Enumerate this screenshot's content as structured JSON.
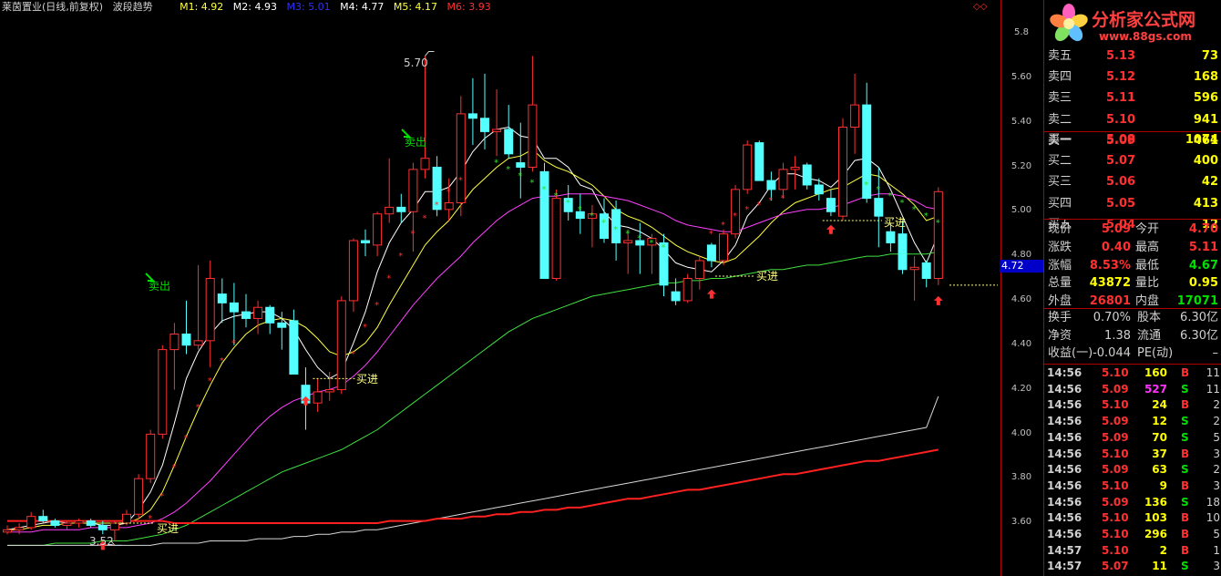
{
  "title_bar": {
    "stock": "莱茵置业(日线,前复权)",
    "indicator": "波段趋势",
    "m1": "M1: 4.92",
    "m2": "M2: 4.93",
    "m3": "M3: 5.01",
    "m4": "M4: 4.77",
    "m5": "M5: 4.17",
    "m6": "M6: 3.93",
    "colors": {
      "m1": "#ffff40",
      "m2": "#ffffff",
      "m3": "#2020ff",
      "m4": "#ffffff",
      "m5": "#ffff40",
      "m6": "#ff3030"
    }
  },
  "price_axis": {
    "ticks": [
      "5.8",
      "5.60",
      "5.40",
      "5.20",
      "5.00",
      "4.80",
      "4.60",
      "4.40",
      "4.20",
      "4.00",
      "3.80",
      "3.60"
    ],
    "current_tag": "4.72"
  },
  "annotations": {
    "high_label": "5.70",
    "low_label": "3.52",
    "sell": "卖出",
    "buy": "买进"
  },
  "logo": {
    "text": "分析家公式网",
    "url": "www.88gs.com"
  },
  "order_book": {
    "asks": [
      {
        "label": "卖五",
        "price": "5.13",
        "vol": "73"
      },
      {
        "label": "卖四",
        "price": "5.12",
        "vol": "168"
      },
      {
        "label": "卖三",
        "price": "5.11",
        "vol": "596"
      },
      {
        "label": "卖二",
        "price": "5.10",
        "vol": "941"
      },
      {
        "label": "卖一",
        "price": "5.09",
        "vol": "461"
      }
    ],
    "bids": [
      {
        "label": "买一",
        "price": "5.08",
        "vol": "1074"
      },
      {
        "label": "买二",
        "price": "5.07",
        "vol": "400"
      },
      {
        "label": "买三",
        "price": "5.06",
        "vol": "42"
      },
      {
        "label": "买四",
        "price": "5.05",
        "vol": "413"
      },
      {
        "label": "买五",
        "price": "5.04",
        "vol": "12"
      }
    ]
  },
  "quote": {
    "rows": [
      {
        "l1": "现价",
        "v1": "5.09",
        "l2": "今开",
        "v2": "4.70"
      },
      {
        "l1": "涨跌",
        "v1": "0.40",
        "l2": "最高",
        "v2": "5.11"
      },
      {
        "l1": "涨幅",
        "v1": "8.53%",
        "l2": "最低",
        "v2": "4.67"
      },
      {
        "l1": "总量",
        "v1": "43872",
        "l2": "量比",
        "v2": "0.95"
      },
      {
        "l1": "外盘",
        "v1": "26801",
        "l2": "内盘",
        "v2": "17071"
      }
    ]
  },
  "fundamentals": {
    "rows": [
      {
        "l1": "换手",
        "v1": "0.70%",
        "l2": "股本",
        "v2": "6.30亿"
      },
      {
        "l1": "净资",
        "v1": "1.38",
        "l2": "流通",
        "v2": "6.30亿"
      },
      {
        "l1": "收益(一)",
        "v1": "-0.044",
        "l2": "PE(动)",
        "v2": "–"
      }
    ]
  },
  "ticks": [
    {
      "time": "14:56",
      "price": "5.10",
      "vol": "160",
      "side": "B",
      "n": "11"
    },
    {
      "time": "14:56",
      "price": "5.09",
      "vol": "527",
      "side": "S",
      "n": "11"
    },
    {
      "time": "14:56",
      "price": "5.10",
      "vol": "24",
      "side": "B",
      "n": "2"
    },
    {
      "time": "14:56",
      "price": "5.09",
      "vol": "12",
      "side": "S",
      "n": "2"
    },
    {
      "time": "14:56",
      "price": "5.09",
      "vol": "70",
      "side": "S",
      "n": "5"
    },
    {
      "time": "14:56",
      "price": "5.10",
      "vol": "37",
      "side": "B",
      "n": "3"
    },
    {
      "time": "14:56",
      "price": "5.09",
      "vol": "63",
      "side": "S",
      "n": "2"
    },
    {
      "time": "14:56",
      "price": "5.10",
      "vol": "9",
      "side": "B",
      "n": "3"
    },
    {
      "time": "14:56",
      "price": "5.09",
      "vol": "136",
      "side": "S",
      "n": "18"
    },
    {
      "time": "14:56",
      "price": "5.10",
      "vol": "103",
      "side": "B",
      "n": "10"
    },
    {
      "time": "14:56",
      "price": "5.10",
      "vol": "296",
      "side": "B",
      "n": "5"
    },
    {
      "time": "14:57",
      "price": "5.10",
      "vol": "2",
      "side": "B",
      "n": "1"
    },
    {
      "time": "14:57",
      "price": "5.07",
      "vol": "11",
      "side": "S",
      "n": "3"
    }
  ],
  "chart_data": {
    "type": "candlestick",
    "ylim": [
      3.5,
      5.85
    ],
    "candles": [
      {
        "o": 3.56,
        "h": 3.59,
        "l": 3.55,
        "c": 3.57
      },
      {
        "o": 3.57,
        "h": 3.6,
        "l": 3.55,
        "c": 3.58
      },
      {
        "o": 3.58,
        "h": 3.65,
        "l": 3.57,
        "c": 3.63
      },
      {
        "o": 3.63,
        "h": 3.66,
        "l": 3.6,
        "c": 3.61
      },
      {
        "o": 3.61,
        "h": 3.62,
        "l": 3.58,
        "c": 3.59
      },
      {
        "o": 3.59,
        "h": 3.61,
        "l": 3.57,
        "c": 3.6
      },
      {
        "o": 3.6,
        "h": 3.62,
        "l": 3.58,
        "c": 3.61
      },
      {
        "o": 3.61,
        "h": 3.62,
        "l": 3.58,
        "c": 3.59
      },
      {
        "o": 3.59,
        "h": 3.61,
        "l": 3.55,
        "c": 3.57
      },
      {
        "o": 3.57,
        "h": 3.61,
        "l": 3.52,
        "c": 3.6
      },
      {
        "o": 3.6,
        "h": 3.66,
        "l": 3.59,
        "c": 3.64
      },
      {
        "o": 3.64,
        "h": 3.82,
        "l": 3.62,
        "c": 3.8
      },
      {
        "o": 3.8,
        "h": 4.02,
        "l": 3.78,
        "c": 4.0
      },
      {
        "o": 4.0,
        "h": 4.4,
        "l": 3.98,
        "c": 4.38
      },
      {
        "o": 4.38,
        "h": 4.5,
        "l": 4.2,
        "c": 4.45
      },
      {
        "o": 4.45,
        "h": 4.6,
        "l": 4.36,
        "c": 4.4
      },
      {
        "o": 4.4,
        "h": 4.76,
        "l": 4.38,
        "c": 4.42
      },
      {
        "o": 4.42,
        "h": 4.78,
        "l": 4.3,
        "c": 4.7
      },
      {
        "o": 4.63,
        "h": 4.7,
        "l": 4.5,
        "c": 4.59
      },
      {
        "o": 4.59,
        "h": 4.68,
        "l": 4.4,
        "c": 4.55
      },
      {
        "o": 4.55,
        "h": 4.63,
        "l": 4.48,
        "c": 4.52
      },
      {
        "o": 4.52,
        "h": 4.6,
        "l": 4.45,
        "c": 4.57
      },
      {
        "o": 4.57,
        "h": 4.58,
        "l": 4.45,
        "c": 4.5
      },
      {
        "o": 4.5,
        "h": 4.55,
        "l": 4.38,
        "c": 4.48
      },
      {
        "o": 4.51,
        "h": 4.56,
        "l": 4.3,
        "c": 4.27
      },
      {
        "o": 4.22,
        "h": 4.3,
        "l": 4.02,
        "c": 4.14
      },
      {
        "o": 4.14,
        "h": 4.25,
        "l": 4.1,
        "c": 4.19
      },
      {
        "o": 4.19,
        "h": 4.28,
        "l": 4.15,
        "c": 4.2
      },
      {
        "o": 4.2,
        "h": 4.62,
        "l": 4.18,
        "c": 4.6
      },
      {
        "o": 4.6,
        "h": 4.88,
        "l": 4.55,
        "c": 4.87
      },
      {
        "o": 4.87,
        "h": 4.92,
        "l": 4.8,
        "c": 4.86
      },
      {
        "o": 4.85,
        "h": 5.0,
        "l": 4.8,
        "c": 4.99
      },
      {
        "o": 4.99,
        "h": 5.24,
        "l": 4.95,
        "c": 5.02
      },
      {
        "o": 5.02,
        "h": 5.08,
        "l": 4.95,
        "c": 5.0
      },
      {
        "o": 5.0,
        "h": 5.22,
        "l": 4.82,
        "c": 5.19
      },
      {
        "o": 5.19,
        "h": 5.7,
        "l": 5.15,
        "c": 5.24
      },
      {
        "o": 5.2,
        "h": 5.25,
        "l": 4.98,
        "c": 5.01
      },
      {
        "o": 5.01,
        "h": 5.15,
        "l": 4.96,
        "c": 5.04
      },
      {
        "o": 5.04,
        "h": 5.52,
        "l": 4.98,
        "c": 5.44
      },
      {
        "o": 5.44,
        "h": 5.6,
        "l": 5.3,
        "c": 5.42
      },
      {
        "o": 5.42,
        "h": 5.62,
        "l": 5.28,
        "c": 5.36
      },
      {
        "o": 5.36,
        "h": 5.55,
        "l": 5.25,
        "c": 5.37
      },
      {
        "o": 5.37,
        "h": 5.48,
        "l": 5.24,
        "c": 5.26
      },
      {
        "o": 5.22,
        "h": 5.4,
        "l": 5.06,
        "c": 5.2
      },
      {
        "o": 5.2,
        "h": 5.7,
        "l": 5.18,
        "c": 5.48
      },
      {
        "o": 5.18,
        "h": 5.22,
        "l": 4.75,
        "c": 4.7
      },
      {
        "o": 4.7,
        "h": 5.1,
        "l": 4.69,
        "c": 5.06
      },
      {
        "o": 5.06,
        "h": 5.12,
        "l": 4.96,
        "c": 5.0
      },
      {
        "o": 5.0,
        "h": 5.08,
        "l": 4.9,
        "c": 4.97
      },
      {
        "o": 4.97,
        "h": 5.03,
        "l": 4.84,
        "c": 4.99
      },
      {
        "o": 4.99,
        "h": 5.06,
        "l": 4.86,
        "c": 4.88
      },
      {
        "o": 5.01,
        "h": 5.05,
        "l": 4.78,
        "c": 4.86
      },
      {
        "o": 4.86,
        "h": 4.92,
        "l": 4.72,
        "c": 4.87
      },
      {
        "o": 4.87,
        "h": 4.95,
        "l": 4.72,
        "c": 4.85
      },
      {
        "o": 4.85,
        "h": 4.9,
        "l": 4.72,
        "c": 4.88
      },
      {
        "o": 4.86,
        "h": 4.9,
        "l": 4.62,
        "c": 4.67
      },
      {
        "o": 4.64,
        "h": 4.7,
        "l": 4.58,
        "c": 4.6
      },
      {
        "o": 4.6,
        "h": 4.72,
        "l": 4.59,
        "c": 4.7
      },
      {
        "o": 4.7,
        "h": 4.8,
        "l": 4.65,
        "c": 4.78
      },
      {
        "o": 4.85,
        "h": 4.86,
        "l": 4.75,
        "c": 4.78
      },
      {
        "o": 4.78,
        "h": 4.92,
        "l": 4.76,
        "c": 4.9
      },
      {
        "o": 4.9,
        "h": 5.12,
        "l": 4.88,
        "c": 5.1
      },
      {
        "o": 5.1,
        "h": 5.32,
        "l": 5.08,
        "c": 5.3
      },
      {
        "o": 5.31,
        "h": 5.32,
        "l": 5.14,
        "c": 5.14
      },
      {
        "o": 5.14,
        "h": 5.18,
        "l": 5.05,
        "c": 5.1
      },
      {
        "o": 5.1,
        "h": 5.22,
        "l": 5.06,
        "c": 5.19
      },
      {
        "o": 5.19,
        "h": 5.25,
        "l": 5.1,
        "c": 5.2
      },
      {
        "o": 5.21,
        "h": 5.22,
        "l": 5.1,
        "c": 5.12
      },
      {
        "o": 5.12,
        "h": 5.15,
        "l": 5.05,
        "c": 5.08
      },
      {
        "o": 5.06,
        "h": 5.1,
        "l": 4.98,
        "c": 5.0
      },
      {
        "o": 4.98,
        "h": 5.42,
        "l": 4.96,
        "c": 5.38
      },
      {
        "o": 5.38,
        "h": 5.62,
        "l": 5.26,
        "c": 5.48
      },
      {
        "o": 5.48,
        "h": 5.58,
        "l": 5.04,
        "c": 5.06
      },
      {
        "o": 5.06,
        "h": 5.2,
        "l": 4.84,
        "c": 4.98
      },
      {
        "o": 4.91,
        "h": 4.95,
        "l": 4.82,
        "c": 4.86
      },
      {
        "o": 4.9,
        "h": 4.96,
        "l": 4.72,
        "c": 4.74
      },
      {
        "o": 4.74,
        "h": 4.8,
        "l": 4.6,
        "c": 4.75
      },
      {
        "o": 4.77,
        "h": 4.78,
        "l": 4.66,
        "c": 4.7
      },
      {
        "o": 4.7,
        "h": 5.11,
        "l": 4.67,
        "c": 5.09
      }
    ],
    "ma_series": [
      {
        "name": "M1",
        "color": "#ffffff",
        "values": [
          3.57,
          3.58,
          3.59,
          3.6,
          3.61,
          3.6,
          3.6,
          3.6,
          3.59,
          3.59,
          3.6,
          3.66,
          3.74,
          3.86,
          4.05,
          4.25,
          4.37,
          4.45,
          4.51,
          4.53,
          4.54,
          4.55,
          4.55,
          4.52,
          4.47,
          4.38,
          4.3,
          4.25,
          4.28,
          4.41,
          4.55,
          4.73,
          4.86,
          4.95,
          5.01,
          5.09,
          5.09,
          5.11,
          5.18,
          5.27,
          5.33,
          5.37,
          5.38,
          5.34,
          5.33,
          5.24,
          5.24,
          5.2,
          5.12,
          5.1,
          5.0,
          4.94,
          4.93,
          4.91,
          4.88,
          4.83,
          4.77,
          4.75,
          4.74,
          4.73,
          4.78,
          4.85,
          4.98,
          5.04,
          5.12,
          5.17,
          5.17,
          5.15,
          5.14,
          5.11,
          5.16,
          5.23,
          5.24,
          5.2,
          5.1,
          4.98,
          4.86,
          4.77,
          4.9
        ]
      },
      {
        "name": "M2",
        "color": "#ffff40",
        "values": [
          3.57,
          3.57,
          3.58,
          3.59,
          3.59,
          3.6,
          3.6,
          3.6,
          3.6,
          3.6,
          3.6,
          3.62,
          3.66,
          3.74,
          3.86,
          3.99,
          4.11,
          4.22,
          4.32,
          4.39,
          4.45,
          4.49,
          4.51,
          4.52,
          4.51,
          4.48,
          4.43,
          4.37,
          4.35,
          4.37,
          4.41,
          4.48,
          4.58,
          4.67,
          4.76,
          4.85,
          4.91,
          4.96,
          5.03,
          5.1,
          5.15,
          5.2,
          5.24,
          5.25,
          5.28,
          5.23,
          5.2,
          5.18,
          5.15,
          5.12,
          5.07,
          5.01,
          4.98,
          4.96,
          4.93,
          4.89,
          4.85,
          4.82,
          4.8,
          4.78,
          4.77,
          4.79,
          4.84,
          4.89,
          4.95,
          5.0,
          5.04,
          5.06,
          5.08,
          5.1,
          5.11,
          5.14,
          5.17,
          5.16,
          5.12,
          5.08,
          5.03,
          4.96,
          4.98
        ]
      },
      {
        "name": "M3",
        "color": "#ff40ff",
        "values": [
          3.56,
          3.56,
          3.56,
          3.57,
          3.57,
          3.57,
          3.57,
          3.58,
          3.58,
          3.58,
          3.58,
          3.59,
          3.6,
          3.62,
          3.65,
          3.69,
          3.74,
          3.79,
          3.85,
          3.91,
          3.97,
          4.03,
          4.08,
          4.12,
          4.15,
          4.17,
          4.19,
          4.2,
          4.22,
          4.26,
          4.31,
          4.37,
          4.44,
          4.51,
          4.58,
          4.64,
          4.7,
          4.75,
          4.8,
          4.86,
          4.91,
          4.96,
          5.0,
          5.03,
          5.06,
          5.07,
          5.07,
          5.08,
          5.08,
          5.08,
          5.07,
          5.06,
          5.05,
          5.03,
          5.01,
          4.99,
          4.96,
          4.94,
          4.93,
          4.92,
          4.91,
          4.91,
          4.93,
          4.95,
          4.97,
          4.99,
          5.0,
          5.01,
          5.01,
          5.02,
          5.03,
          5.05,
          5.07,
          5.08,
          5.08,
          5.07,
          5.05,
          5.02,
          5.01
        ]
      },
      {
        "name": "M4",
        "color": "#40e040",
        "values": [
          3.5,
          3.5,
          3.5,
          3.5,
          3.51,
          3.51,
          3.51,
          3.51,
          3.52,
          3.52,
          3.52,
          3.53,
          3.54,
          3.55,
          3.57,
          3.59,
          3.62,
          3.65,
          3.68,
          3.71,
          3.74,
          3.77,
          3.8,
          3.83,
          3.85,
          3.87,
          3.89,
          3.91,
          3.93,
          3.96,
          3.99,
          4.02,
          4.06,
          4.1,
          4.14,
          4.18,
          4.22,
          4.26,
          4.3,
          4.34,
          4.38,
          4.42,
          4.46,
          4.49,
          4.52,
          4.54,
          4.56,
          4.58,
          4.6,
          4.62,
          4.63,
          4.64,
          4.65,
          4.66,
          4.67,
          4.68,
          4.68,
          4.69,
          4.69,
          4.7,
          4.7,
          4.71,
          4.72,
          4.73,
          4.74,
          4.74,
          4.75,
          4.76,
          4.76,
          4.77,
          4.78,
          4.79,
          4.8,
          4.8,
          4.81,
          4.81,
          4.81,
          4.81,
          4.82
        ]
      },
      {
        "name": "M5",
        "color": "#d8d8d8",
        "values": [
          3.5,
          3.5,
          3.5,
          3.5,
          3.5,
          3.5,
          3.5,
          3.5,
          3.5,
          3.5,
          3.5,
          3.5,
          3.5,
          3.51,
          3.51,
          3.51,
          3.51,
          3.52,
          3.52,
          3.52,
          3.52,
          3.53,
          3.53,
          3.53,
          3.54,
          3.54,
          3.55,
          3.55,
          3.56,
          3.56,
          3.57,
          3.57,
          3.58,
          3.59,
          3.6,
          3.61,
          3.62,
          3.63,
          3.64,
          3.65,
          3.66,
          3.67,
          3.68,
          3.69,
          3.7,
          3.71,
          3.72,
          3.73,
          3.74,
          3.75,
          3.76,
          3.77,
          3.78,
          3.79,
          3.8,
          3.81,
          3.82,
          3.83,
          3.84,
          3.85,
          3.86,
          3.87,
          3.88,
          3.89,
          3.9,
          3.91,
          3.92,
          3.93,
          3.94,
          3.95,
          3.96,
          3.97,
          3.98,
          3.99,
          4.0,
          4.01,
          4.02,
          4.03,
          4.17
        ]
      },
      {
        "name": "M6",
        "color": "#ff2020",
        "values": [
          3.61,
          3.61,
          3.61,
          3.61,
          3.61,
          3.61,
          3.61,
          3.61,
          3.61,
          3.61,
          3.61,
          3.61,
          3.61,
          3.61,
          3.6,
          3.6,
          3.6,
          3.6,
          3.6,
          3.6,
          3.6,
          3.6,
          3.6,
          3.6,
          3.6,
          3.6,
          3.6,
          3.6,
          3.6,
          3.6,
          3.6,
          3.6,
          3.61,
          3.61,
          3.61,
          3.61,
          3.62,
          3.62,
          3.62,
          3.63,
          3.63,
          3.64,
          3.64,
          3.65,
          3.65,
          3.66,
          3.66,
          3.67,
          3.67,
          3.68,
          3.69,
          3.7,
          3.71,
          3.71,
          3.72,
          3.73,
          3.74,
          3.75,
          3.75,
          3.76,
          3.77,
          3.78,
          3.79,
          3.8,
          3.81,
          3.82,
          3.82,
          3.83,
          3.84,
          3.85,
          3.86,
          3.87,
          3.88,
          3.88,
          3.89,
          3.9,
          3.91,
          3.92,
          3.93
        ]
      }
    ]
  }
}
